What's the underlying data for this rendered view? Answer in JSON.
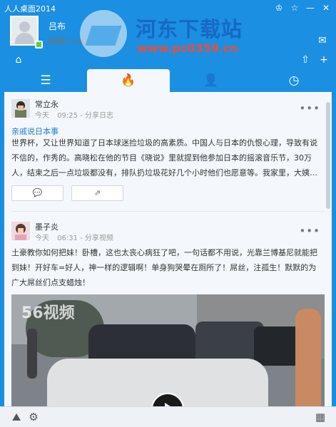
{
  "window": {
    "title": "人人桌面2014",
    "controls": [
      "♔",
      "☆",
      "—",
      "✕"
    ]
  },
  "profile": {
    "name": "吕布",
    "status_placeholder": "编辑个人签名"
  },
  "watermark": {
    "title": "河东下载站",
    "url": "www.pc0359.cn"
  },
  "header_icons": {
    "message": "✉",
    "home": "⌂",
    "upload": "⇧",
    "add": "+"
  },
  "nav": {
    "tabs": [
      {
        "name": "menu",
        "glyph": "☰"
      },
      {
        "name": "feed",
        "glyph": "🔥"
      },
      {
        "name": "friends",
        "glyph": "👤"
      },
      {
        "name": "recent",
        "glyph": "◷"
      }
    ]
  },
  "posts": [
    {
      "author": "常立永",
      "day": "今天",
      "time": "09:25",
      "action": "分享日志",
      "link": "亲戚说日本事",
      "text": "世界杯，又让世界知道了日本球迷捡垃圾的高素质。中国人与日本的仇恨心理，导致有说不信的，作秀的。高晓松在他的节目《晓说》里就提到他参加日本的摇滚音乐节，30万人，结束之后一点垃圾都没有，排队扔垃圾花好几个小时他们也愿意等。我家里，大姨…",
      "buttons": {
        "comment": "💬",
        "share": "⇗"
      }
    },
    {
      "author": "墨子炎",
      "day": "今天",
      "time": "06:31",
      "action": "分享视频",
      "text": "土豪教你如何把妹！卧槽，这也太丧心病狂了吧，一句话都不用说，光靠兰博基尼就能把到妹！开好车=好人，神一样的逻辑啊！单身狗哭晕在厕所了！屌丝，注孤生！默默的为广大屌丝们点支蜡烛！",
      "video_logo": "56视频"
    }
  ],
  "more_label": "•••",
  "bottom": {
    "left1": "⛰",
    "left2": "⚙",
    "right": "▦"
  }
}
